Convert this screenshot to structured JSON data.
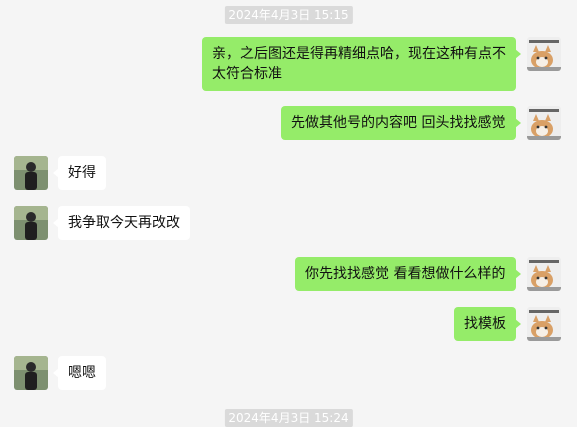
{
  "chat": {
    "timestamps": [
      "2024年4月3日 15:15",
      "2024年4月3日 15:24"
    ],
    "messages": [
      {
        "side": "out",
        "text": "亲，之后图还是得再精细点哈，现在这种有点不太符合标准"
      },
      {
        "side": "out",
        "text": "先做其他号的内容吧 回头找找感觉"
      },
      {
        "side": "in",
        "text": "好得"
      },
      {
        "side": "in",
        "text": "我争取今天再改改"
      },
      {
        "side": "out",
        "text": "你先找找感觉 看看想做什么样的"
      },
      {
        "side": "out",
        "text": "找模板"
      },
      {
        "side": "in",
        "text": "嗯嗯"
      }
    ],
    "my_avatar_icon": "cat-photo-avatar",
    "contact_avatar_icon": "person-photo-avatar",
    "colors": {
      "outgoing_bubble": "#95ec69",
      "incoming_bubble": "#ffffff",
      "background": "#f5f5f5"
    }
  }
}
